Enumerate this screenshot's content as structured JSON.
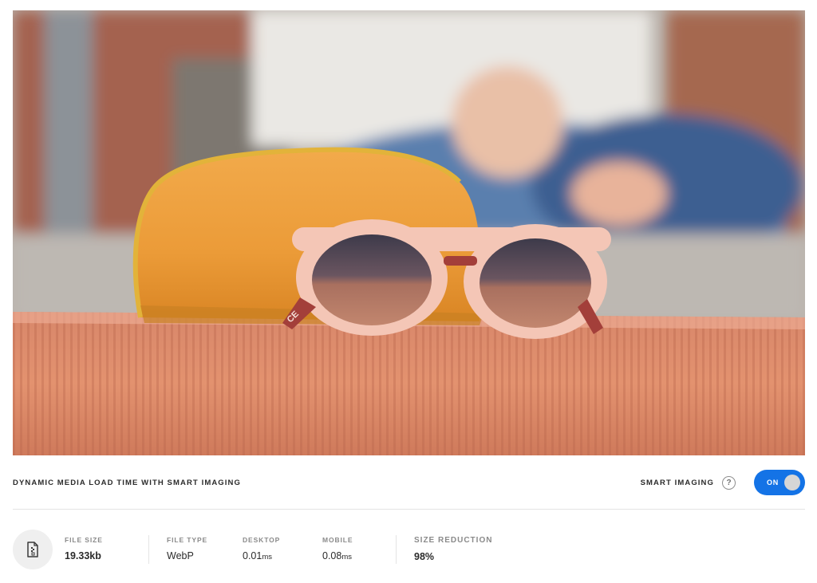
{
  "hero": {
    "alt_icon": "sunglasses-product-photo",
    "lens_text": "CE"
  },
  "bar": {
    "title": "DYNAMIC MEDIA LOAD TIME WITH SMART IMAGING",
    "smart_imaging_label": "SMART IMAGING",
    "help_glyph": "?",
    "toggle_label": "ON",
    "toggle_state": "on",
    "accent_color": "#1473e6"
  },
  "stats": {
    "file_icon": "document-file-icon",
    "file_size": {
      "label": "FILE SIZE",
      "value": "19.33kb"
    },
    "file_type": {
      "label": "FILE TYPE",
      "value": "WebP"
    },
    "desktop": {
      "label": "DESKTOP",
      "value": "0.01",
      "unit": "ms"
    },
    "mobile": {
      "label": "MOBILE",
      "value": "0.08",
      "unit": "ms"
    },
    "size_reduction": {
      "label": "SIZE REDUCTION",
      "value": "98%"
    }
  }
}
